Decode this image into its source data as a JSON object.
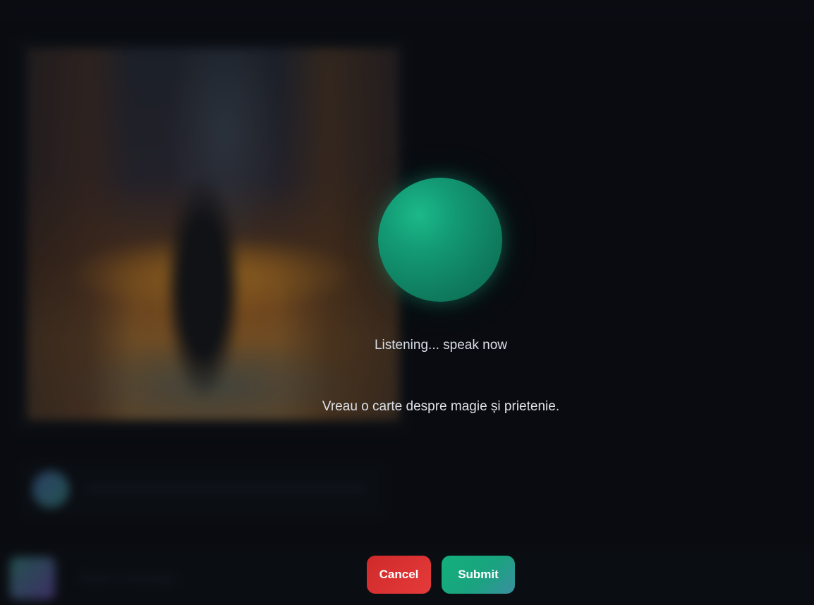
{
  "background": {
    "input_placeholder": "Send a message..."
  },
  "voice": {
    "orb_color": "#139a74",
    "status": "Listening... speak now",
    "transcript": "Vreau o carte despre magie și prietenie."
  },
  "actions": {
    "cancel_label": "Cancel",
    "submit_label": "Submit",
    "cancel_color": "#e03434",
    "submit_color": "#14b07c"
  }
}
